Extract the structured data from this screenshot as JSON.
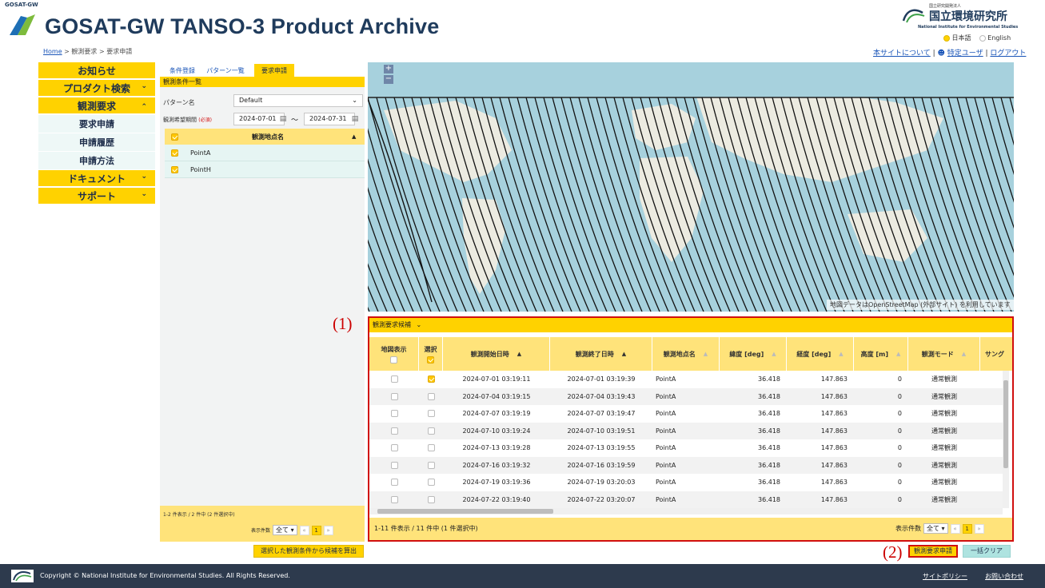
{
  "header": {
    "small_logo_text": "GOSAT-GW",
    "title": "GOSAT-GW TANSO-3 Product Archive",
    "breadcrumb": {
      "home": "Home",
      "sep": ">",
      "level1": "観測要求",
      "level2": "要求申請"
    },
    "org_logo_name": "国立環境研究所",
    "org_logo_sub": "National Institute for Environmental Studies",
    "org_logo_top": "国立研究開発法人",
    "lang_options": [
      "日本語",
      "English"
    ],
    "lang_selected": "日本語",
    "links": {
      "about": "本サイトについて",
      "sep": "|",
      "user": "特定ユーザ",
      "logout": "ログアウト"
    }
  },
  "sidebar": {
    "items": [
      {
        "label": "お知らせ",
        "chevron": ""
      },
      {
        "label": "プロダクト検索",
        "chevron": "⌄"
      },
      {
        "label": "観測要求",
        "chevron": "⌃"
      }
    ],
    "sub_items": [
      "要求申請",
      "申請履歴",
      "申請方法"
    ],
    "more_items": [
      {
        "label": "ドキュメント",
        "chevron": "⌄"
      },
      {
        "label": "サポート",
        "chevron": "⌄"
      }
    ]
  },
  "cond_panel": {
    "tabs": [
      "条件登録",
      "パターン一覧",
      "要求申請"
    ],
    "active_tab": "要求申請",
    "list_title": "観測条件一覧",
    "pattern_label": "パターン名",
    "pattern_value": "Default",
    "period_label": "観測希望期間",
    "required": "(必須)",
    "date_from": "2024-07-01",
    "date_sep": "～",
    "date_to": "2024-07-31",
    "col_name": "観測地点名",
    "points": [
      "PointA",
      "PointH"
    ],
    "footer_count": "1-2 件表示 / 2 件中 (2 件選択中)",
    "per_page_label": "表示件数",
    "per_page_value": "全て",
    "page_first": "«",
    "page_num": "1",
    "page_last": "»",
    "calc_button": "選択した観測条件から候補を算出"
  },
  "map": {
    "zoom_in": "+",
    "zoom_out": "−",
    "attribution": "地図データはOpenStreetMap (外部サイト) を利用しています"
  },
  "results": {
    "annotation": "(1)",
    "header": "観測要求候補",
    "columns": [
      "地図表示",
      "選択",
      "観測開始日時",
      "観測終了日時",
      "観測地点名",
      "緯度 [deg]",
      "経度 [deg]",
      "高度 [m]",
      "観測モード",
      "サング"
    ],
    "rows": [
      {
        "start": "2024-07-01 03:19:11",
        "end": "2024-07-01 03:19:39",
        "point": "PointA",
        "lat": "36.418",
        "lon": "147.863",
        "alt": "0",
        "mode": "通常観測",
        "selected": true
      },
      {
        "start": "2024-07-04 03:19:15",
        "end": "2024-07-04 03:19:43",
        "point": "PointA",
        "lat": "36.418",
        "lon": "147.863",
        "alt": "0",
        "mode": "通常観測",
        "selected": false
      },
      {
        "start": "2024-07-07 03:19:19",
        "end": "2024-07-07 03:19:47",
        "point": "PointA",
        "lat": "36.418",
        "lon": "147.863",
        "alt": "0",
        "mode": "通常観測",
        "selected": false
      },
      {
        "start": "2024-07-10 03:19:24",
        "end": "2024-07-10 03:19:51",
        "point": "PointA",
        "lat": "36.418",
        "lon": "147.863",
        "alt": "0",
        "mode": "通常観測",
        "selected": false
      },
      {
        "start": "2024-07-13 03:19:28",
        "end": "2024-07-13 03:19:55",
        "point": "PointA",
        "lat": "36.418",
        "lon": "147.863",
        "alt": "0",
        "mode": "通常観測",
        "selected": false
      },
      {
        "start": "2024-07-16 03:19:32",
        "end": "2024-07-16 03:19:59",
        "point": "PointA",
        "lat": "36.418",
        "lon": "147.863",
        "alt": "0",
        "mode": "通常観測",
        "selected": false
      },
      {
        "start": "2024-07-19 03:19:36",
        "end": "2024-07-19 03:20:03",
        "point": "PointA",
        "lat": "36.418",
        "lon": "147.863",
        "alt": "0",
        "mode": "通常観測",
        "selected": false
      },
      {
        "start": "2024-07-22 03:19:40",
        "end": "2024-07-22 03:20:07",
        "point": "PointA",
        "lat": "36.418",
        "lon": "147.863",
        "alt": "0",
        "mode": "通常観測",
        "selected": false
      }
    ],
    "footer_count": "1-11 件表示 / 11 件中 (1 件選択中)",
    "per_page_label": "表示件数",
    "per_page_value": "全て",
    "page_first": "«",
    "page_num": "1",
    "page_last": "»"
  },
  "actions": {
    "annotation": "(2)",
    "submit": "観測要求申請",
    "clear": "一括クリア"
  },
  "footer": {
    "copyright": "Copyright © National Institute for Environmental Studies. All Rights Reserved.",
    "policy": "サイトポリシー",
    "contact": "お問い合わせ"
  },
  "colors": {
    "accent_yellow": "#ffd200",
    "light_yellow": "#ffe37a",
    "title_navy": "#1f3b5c",
    "footer_bg": "#2d3a4d",
    "annotation_red": "#d10f0f"
  }
}
